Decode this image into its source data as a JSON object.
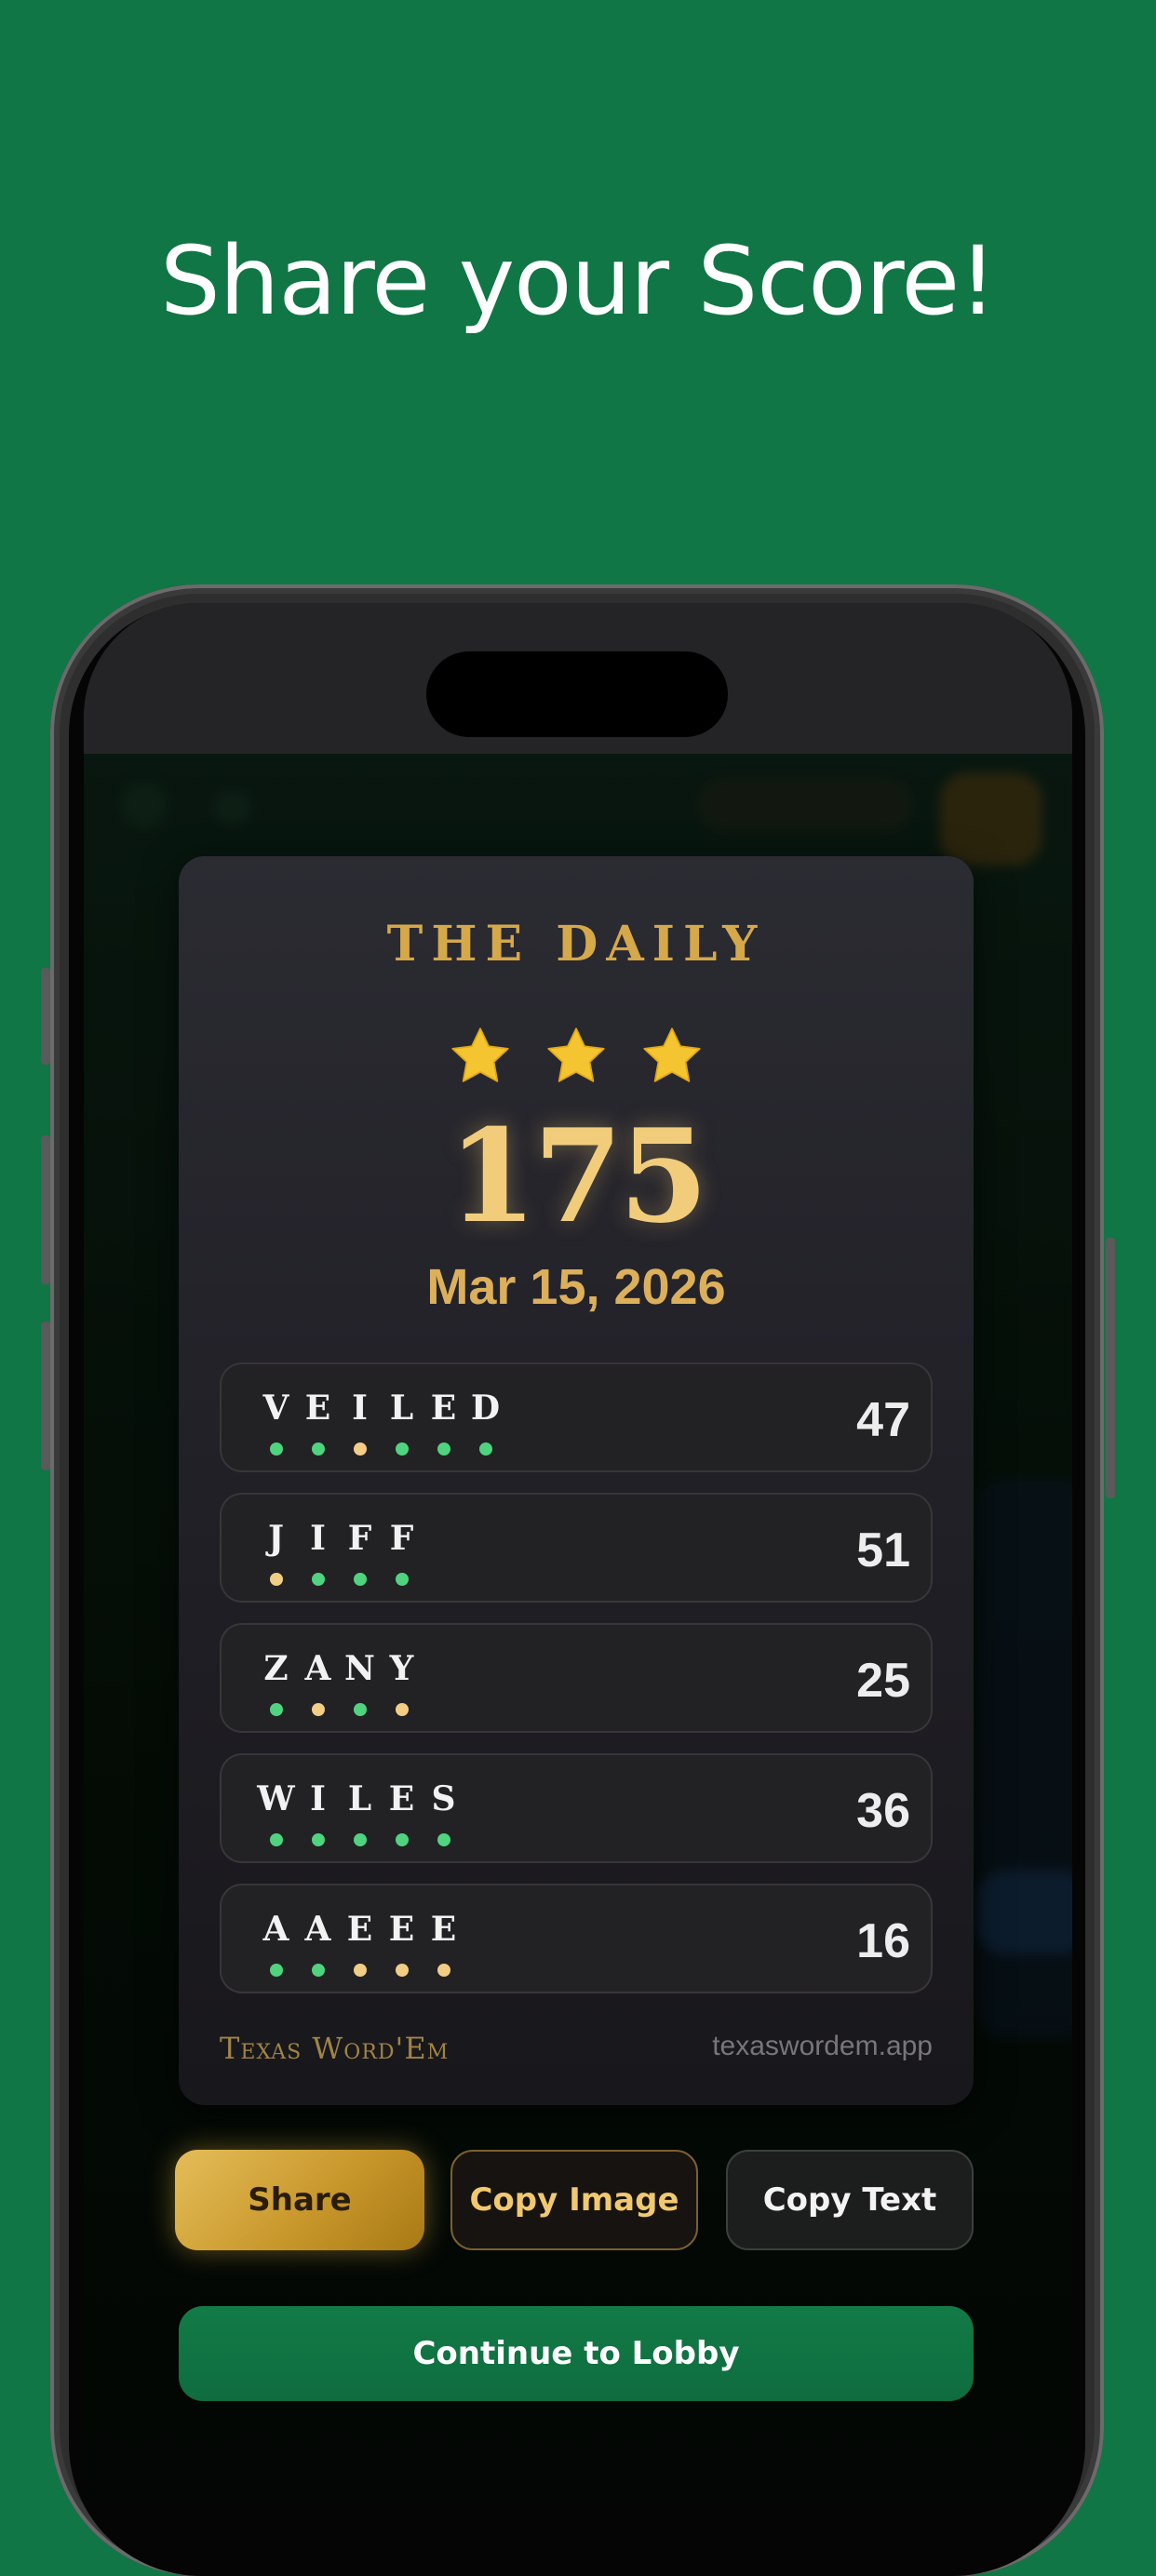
{
  "headline": "Share your Score!",
  "card": {
    "title": "THE DAILY",
    "stars_earned": 3,
    "stars_total": 3,
    "score": "175",
    "date": "Mar 15, 2026",
    "brand": "Texas Word'Em",
    "url": "texaswordem.app",
    "rows": [
      {
        "word": "VEILED",
        "score": "47",
        "dots": [
          "green",
          "green",
          "gold",
          "green",
          "green",
          "green"
        ]
      },
      {
        "word": "JIFF",
        "score": "51",
        "dots": [
          "gold",
          "green",
          "green",
          "green"
        ]
      },
      {
        "word": "ZANY",
        "score": "25",
        "dots": [
          "green",
          "gold",
          "green",
          "gold"
        ]
      },
      {
        "word": "WILES",
        "score": "36",
        "dots": [
          "green",
          "green",
          "green",
          "green",
          "green"
        ]
      },
      {
        "word": "AAEEE",
        "score": "16",
        "dots": [
          "green",
          "green",
          "gold",
          "gold",
          "gold"
        ]
      }
    ]
  },
  "buttons": {
    "share": "Share",
    "copy_image": "Copy Image",
    "copy_text": "Copy Text",
    "continue": "Continue to Lobby"
  },
  "colors": {
    "background": "#117645",
    "accent_gold": "#d5a84a",
    "dot_green": "#4fd37f",
    "dot_gold": "#f2ce84"
  }
}
